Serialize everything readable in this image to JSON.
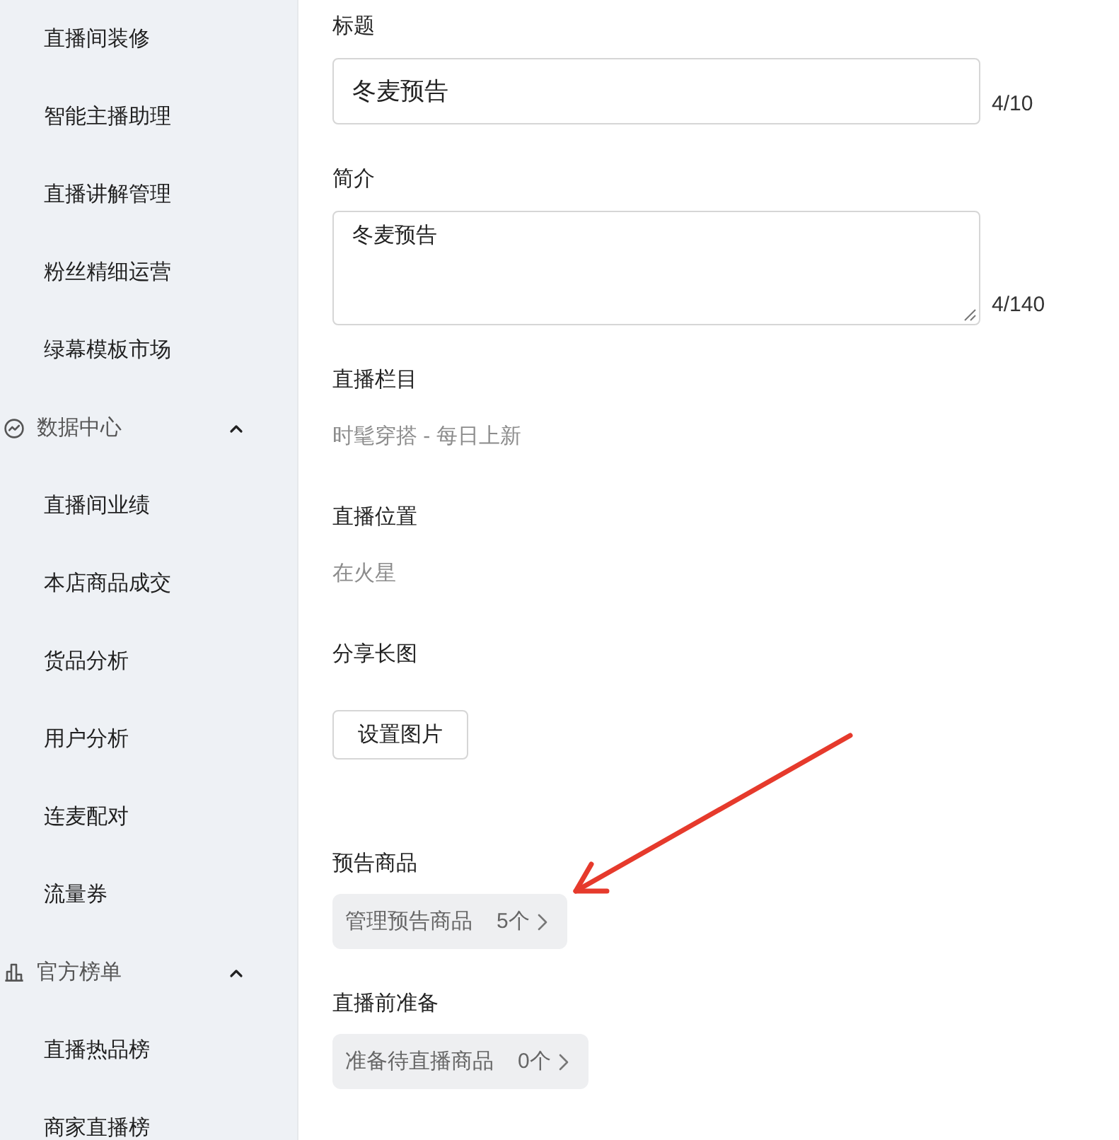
{
  "sidebar": {
    "items": [
      {
        "label": "直播间装修"
      },
      {
        "label": "智能主播助理"
      },
      {
        "label": "直播讲解管理"
      },
      {
        "label": "粉丝精细运营"
      },
      {
        "label": "绿幕模板市场"
      }
    ],
    "groups": [
      {
        "label": "数据中心",
        "expanded": true,
        "children": [
          {
            "label": "直播间业绩"
          },
          {
            "label": "本店商品成交"
          },
          {
            "label": "货品分析"
          },
          {
            "label": "用户分析"
          },
          {
            "label": "连麦配对"
          },
          {
            "label": "流量券"
          }
        ]
      },
      {
        "label": "官方榜单",
        "expanded": true,
        "children": [
          {
            "label": "直播热品榜"
          },
          {
            "label": "商家直播榜"
          }
        ]
      }
    ]
  },
  "form": {
    "fields": [
      {
        "kind": "text_input",
        "label": "标题",
        "value": "冬麦预告",
        "counter": "4/10"
      },
      {
        "kind": "textarea",
        "label": "简介",
        "value": "冬麦预告",
        "counter": "4/140"
      },
      {
        "kind": "static",
        "label": "直播栏目",
        "value": "时髦穿搭 - 每日上新"
      },
      {
        "kind": "static",
        "label": "直播位置",
        "value": "在火星"
      },
      {
        "kind": "button",
        "label": "分享长图",
        "button": "设置图片"
      },
      {
        "kind": "link_chip",
        "label": "预告商品",
        "text": "管理预告商品",
        "count": "5个"
      },
      {
        "kind": "link_chip",
        "label": "直播前准备",
        "text": "准备待直播商品",
        "count": "0个"
      }
    ]
  }
}
